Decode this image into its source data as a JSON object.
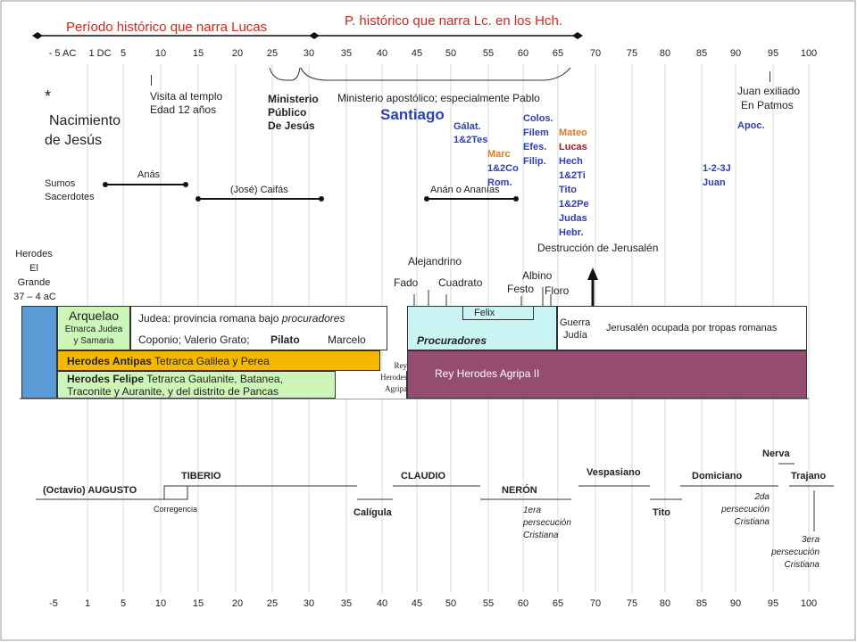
{
  "periods": {
    "lucas_gospel": "Período histórico que narra Lucas",
    "lucas_acts": "P. histórico que narra Lc. en los Hch."
  },
  "axis_top": [
    "- 5 AC",
    "1 DC",
    "5",
    "10",
    "15",
    "20",
    "25",
    "30",
    "35",
    "40",
    "45",
    "50",
    "55",
    "60",
    "65",
    "70",
    "75",
    "80",
    "85",
    "90",
    "95",
    "100"
  ],
  "axis_bottom": [
    "-5",
    "1",
    "5",
    "10",
    "15",
    "20",
    "25",
    "30",
    "35",
    "40",
    "45",
    "50",
    "55",
    "60",
    "65",
    "70",
    "75",
    "80",
    "85",
    "90",
    "95",
    "100"
  ],
  "events": {
    "asterisk": "*",
    "birth_line1": "Nacimiento",
    "birth_line2": "de Jesús",
    "temple_line1": "Visita al templo",
    "temple_line2": "Edad 12 años",
    "ministry_line1": "Ministerio",
    "ministry_line2": "Público",
    "ministry_line3": "De Jesús",
    "apostolic": "Ministerio apostólico; especialmente Pablo",
    "santiago": "Santiago",
    "galat_1": "Gálat.",
    "galat_2": "1&2Tes",
    "marc_1": "Marc",
    "marc_2": "1&2Co",
    "marc_3": "Rom.",
    "colos_1": "Colos.",
    "colos_2": "Filem",
    "colos_3": "Efes.",
    "colos_4": "Filip.",
    "mateo": "Mateo",
    "lucas": "Lucas",
    "hech": "Hech",
    "ti": "1&2Ti",
    "tito": "Tito",
    "pe": "1&2Pe",
    "judas": "Judas",
    "hebr": "Hebr.",
    "destruction": "Destrucción de Jerusalén",
    "juan_exile_1": "Juan exiliado",
    "juan_exile_2": "En Patmos",
    "apoc": "Apoc.",
    "juan_letters_1": "1-2-3J",
    "juan_letters_2": "Juan"
  },
  "priests": {
    "label_1": "Sumos",
    "label_2": "Sacerdotes",
    "anas": "Anás",
    "caifas": "(José) Caifás",
    "ananias": "Anán o Ananías"
  },
  "rulers": {
    "herodes_1": "Herodes",
    "herodes_2": "El",
    "herodes_3": "Grande",
    "herodes_4": "37 – 4 aC",
    "arquelao": "Arquelao",
    "arquelao_sub1": "Etnarca Judea",
    "arquelao_sub2": "y Samaria",
    "judea_prefix": "Judea: provincia romana bajo ",
    "judea_em": "procuradores",
    "coponio": "Coponio; Valerio Grato;",
    "pilato": "Pilato",
    "marcelo": "Marcelo",
    "antipas_name": "Herodes Antipas",
    "antipas_rest": " Tetrarca  Galilea y Perea",
    "felipe_name": "Herodes Felipe",
    "felipe_rest": " Tetrarca  Gaulanite, Batanea,",
    "felipe_line2": "Traconite y Auranite,  y del distrito de Pancas",
    "rey_1": "Rey",
    "rey_2": "Herodes",
    "rey_3": "Agripa",
    "alejandrino": "Alejandrino",
    "fado": "Fado",
    "cuadrato": "Cuadrato",
    "albino": "Albino",
    "festo": "Festo",
    "floro": "Floro",
    "felix": "Felix",
    "procuradores": "Procuradores",
    "guerra_1": "Guerra",
    "guerra_2": "Judía",
    "jerusalen": "Jerusalén  ocupada por tropas romanas",
    "agripa2": "Rey Herodes Agripa II"
  },
  "emperors": {
    "nerva": "Nerva",
    "tiberio": "TIBERIO",
    "claudio": "CLAUDIO",
    "vespasiano": "Vespasiano",
    "domiciano": "Domiciano",
    "trajano": "Trajano",
    "augusto": "(Octavio)  AUGUSTO",
    "neron": "NERÓN",
    "corregencia": "Corregencia",
    "caligula": "Calígula",
    "tito": "Tito",
    "pers1_1": "1era",
    "pers1_2": "persecución",
    "pers1_3": "Cristiana",
    "pers2_1": "2da",
    "pers2_2": "persecución",
    "pers2_3": "Cristiana",
    "pers3_1": "3era",
    "pers3_2": "persecución",
    "pers3_3": "Cristiana"
  },
  "colors": {
    "herodes_bar": "#5b9bd5",
    "arquelao_box": "#ccf5b8",
    "antipas_bar": "#f5b800",
    "felipe_box": "#ccf5b8",
    "procuradores_box": "#c9f4f4",
    "agripa_box": "#944d6f",
    "red_text": "#d8261c",
    "blue_text": "#2a3fb8",
    "orange_text": "#e07a1f"
  }
}
